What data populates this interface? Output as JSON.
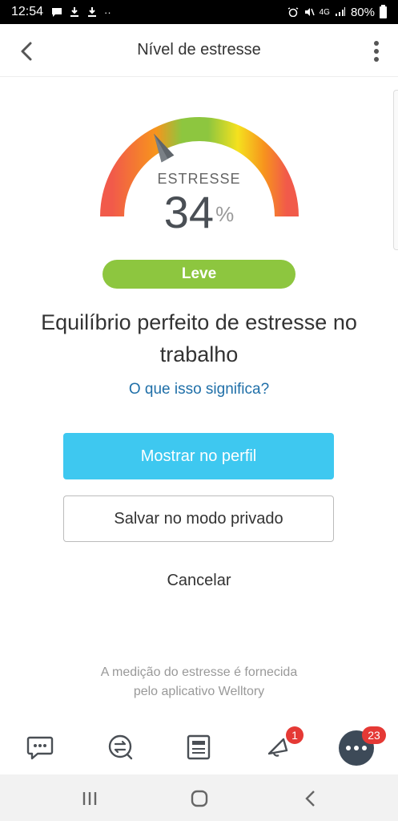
{
  "status_bar": {
    "time": "12:54",
    "network": "4G",
    "battery": "80%"
  },
  "header": {
    "title": "Nível de estresse",
    "back_icon": "chevron-left-icon",
    "more_icon": "more-vertical-icon"
  },
  "gauge": {
    "label": "ESTRESSE",
    "value": "34",
    "unit": "%",
    "level_fraction": 0.34,
    "colors": [
      "#f15a4a",
      "#8dc63f",
      "#f5e11e",
      "#f15a4a"
    ]
  },
  "level": {
    "label": "Leve",
    "color": "#8dc63f"
  },
  "headline": "Equilíbrio perfeito de estresse no trabalho",
  "info_link": "O que isso significa?",
  "buttons": {
    "show_profile": "Mostrar no perfil",
    "save_private": "Salvar no modo privado",
    "cancel": "Cancelar"
  },
  "footer_note": {
    "line1": "A medição do estresse é fornecida",
    "line2": "pelo aplicativo Welltory"
  },
  "tabbar": {
    "chat_icon": "chat-bubble-icon",
    "activity_icon": "activity-exchange-icon",
    "feed_icon": "news-card-icon",
    "notifications_icon": "bell-icon",
    "notifications_badge": "1",
    "more_icon": "more-horizontal-icon",
    "more_badge": "23"
  },
  "android_nav": {
    "recents_icon": "recents-icon",
    "home_icon": "home-icon",
    "back_icon": "back-arrow-icon"
  },
  "colors": {
    "primary": "#3ec8f0",
    "link": "#1f6fa8",
    "badge": "#e53935"
  }
}
